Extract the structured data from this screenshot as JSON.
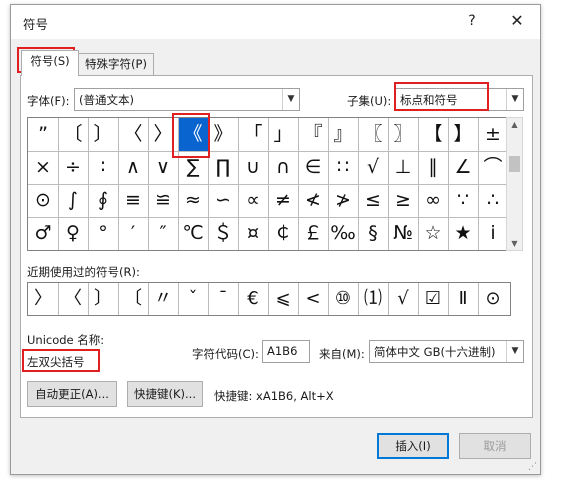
{
  "dialog": {
    "title": "符号",
    "help_icon": "?",
    "close_icon": "✕"
  },
  "tabs": [
    {
      "label": "符号(S)"
    },
    {
      "label": "特殊字符(P)"
    }
  ],
  "font": {
    "label": "字体(F):",
    "value": "(普通文本)"
  },
  "subset": {
    "label": "子集(U):",
    "value": "标点和符号"
  },
  "symbols": [
    [
      "”",
      "〔",
      "〕",
      "〈",
      "〉",
      "《",
      "》",
      "「",
      "」",
      "『",
      "』",
      "〖",
      "〗",
      "【",
      "】",
      "±"
    ],
    [
      "×",
      "÷",
      "∶",
      "∧",
      "∨",
      "∑",
      "∏",
      "∪",
      "∩",
      "∈",
      "∷",
      "√",
      "⊥",
      "∥",
      "∠",
      "⌒"
    ],
    [
      "⊙",
      "∫",
      "∮",
      "≡",
      "≌",
      "≈",
      "∽",
      "∝",
      "≠",
      "≮",
      "≯",
      "≤",
      "≥",
      "∞",
      "∵",
      "∴"
    ],
    [
      "♂",
      "♀",
      "°",
      "′",
      "″",
      "℃",
      "＄",
      "¤",
      "￠",
      "￡",
      "‰",
      "§",
      "№",
      "☆",
      "★",
      "ⅰ"
    ]
  ],
  "selected_symbol": "《",
  "recent": {
    "label": "近期使用过的符号(R):",
    "items": [
      "〉",
      "〈",
      "〕",
      "〔",
      "〃",
      "ˇ",
      "ˉ",
      "€",
      "⩽",
      "<",
      "⑩",
      "⑴",
      "√",
      "☑",
      "Ⅱ",
      "⊙"
    ]
  },
  "unicode": {
    "label": "Unicode 名称:",
    "name": "左双尖括号"
  },
  "char_code": {
    "label": "字符代码(C):",
    "value": "A1B6"
  },
  "from": {
    "label": "来自(M):",
    "value": "简体中文 GB(十六进制)"
  },
  "buttons": {
    "autocorrect": "自动更正(A)...",
    "shortcut_key": "快捷键(K)...",
    "insert": "插入(I)",
    "cancel": "取消"
  },
  "shortcut_text": "快捷键: xA1B6, Alt+X",
  "accent_colors": {
    "selection": "#0a64d0",
    "annotation": "#e02020",
    "default_button": "#0078d7"
  }
}
